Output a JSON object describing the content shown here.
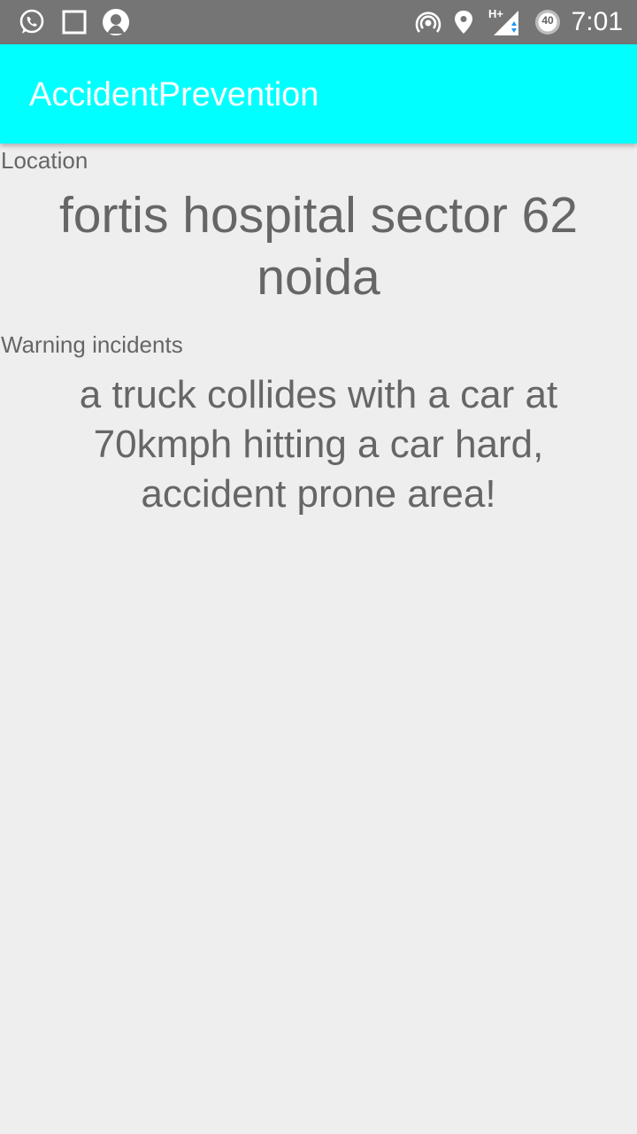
{
  "status_bar": {
    "time": "7:01",
    "network_label": "H+",
    "battery_level": "40",
    "left_icons": [
      "whatsapp-icon",
      "square-notification-icon",
      "app-notification-icon"
    ],
    "right_icons": [
      "hotspot-icon",
      "location-pin-icon",
      "signal-icon",
      "battery-icon"
    ]
  },
  "app_bar": {
    "title": "AccidentPrevention",
    "background_color": "#00ffff"
  },
  "location": {
    "label": "Location",
    "value": "fortis hospital sector 62 noida"
  },
  "warning": {
    "label": "Warning incidents",
    "value": "a truck collides with a car at 70kmph hitting a car hard, accident prone area!"
  }
}
